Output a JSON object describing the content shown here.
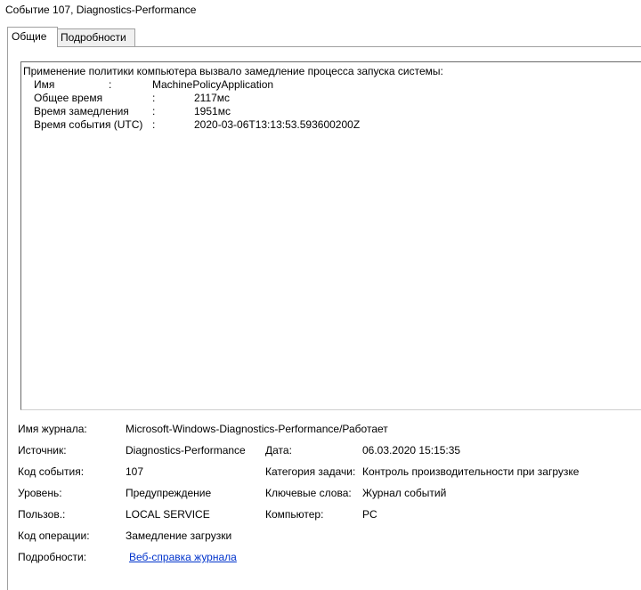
{
  "window": {
    "title": "Событие 107, Diagnostics-Performance"
  },
  "tabs": [
    {
      "label": "Общие",
      "active": true
    },
    {
      "label": "Подробности",
      "active": false
    }
  ],
  "description": {
    "headline": "Применение политики компьютера вызвало замедление процесса запуска системы:",
    "rows": [
      {
        "key": "Имя",
        "sep": ":",
        "value": "MachinePolicyApplication"
      },
      {
        "key": "Общее время",
        "sep": ":",
        "value": "2117мс"
      },
      {
        "key": "Время замедления",
        "sep": ":",
        "value": "1951мс"
      },
      {
        "key": "Время события (UTC)",
        "sep": ":",
        "value": "2020-03-06T13:13:53.593600200Z"
      }
    ]
  },
  "meta": {
    "log_name": {
      "label": "Имя журнала:",
      "value": "Microsoft-Windows-Diagnostics-Performance/Работает"
    },
    "source": {
      "label": "Источник:",
      "value": "Diagnostics-Performance"
    },
    "date": {
      "label": "Дата:",
      "value": "06.03.2020 15:15:35"
    },
    "event_id": {
      "label": "Код события:",
      "value": "107"
    },
    "task_category": {
      "label": "Категория задачи:",
      "value": "Контроль производительности при загрузке"
    },
    "level": {
      "label": "Уровень:",
      "value": "Предупреждение"
    },
    "keywords": {
      "label": "Ключевые слова:",
      "value": "Журнал событий"
    },
    "user": {
      "label": "Пользов.:",
      "value": "LOCAL SERVICE"
    },
    "computer": {
      "label": "Компьютер:",
      "value": "PC"
    },
    "opcode": {
      "label": "Код операции:",
      "value": "Замедление загрузки"
    },
    "more_info": {
      "label": "Подробности:",
      "link": "Веб-справка журнала"
    }
  }
}
